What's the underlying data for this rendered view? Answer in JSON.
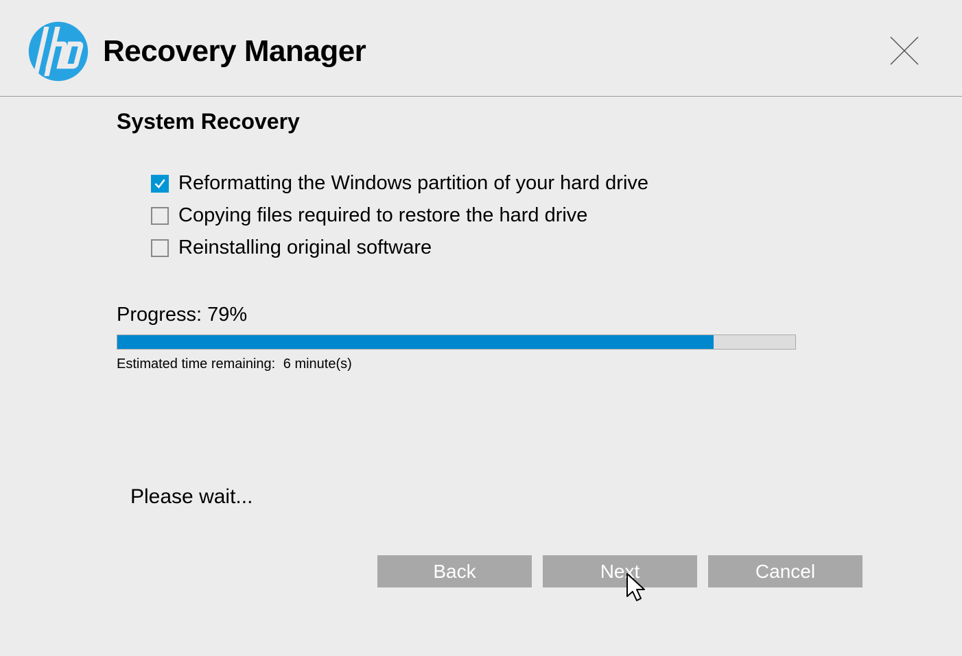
{
  "header": {
    "title": "Recovery Manager"
  },
  "page": {
    "subtitle": "System Recovery",
    "steps": [
      {
        "label": "Reformatting the Windows partition of your hard drive",
        "done": true
      },
      {
        "label": "Copying files required to restore the hard drive",
        "done": false
      },
      {
        "label": "Reinstalling original software",
        "done": false
      }
    ],
    "progress_label": "Progress:",
    "progress_pct": "79%",
    "progress_value": 79,
    "eta_label": "Estimated time remaining:",
    "eta_value": "6 minute(s)",
    "wait_text": "Please wait..."
  },
  "buttons": {
    "back": "Back",
    "next": "Next",
    "cancel": "Cancel"
  },
  "colors": {
    "accent": "#0096d6",
    "progress": "#0088cf",
    "button_bg": "#a8a8a8"
  }
}
